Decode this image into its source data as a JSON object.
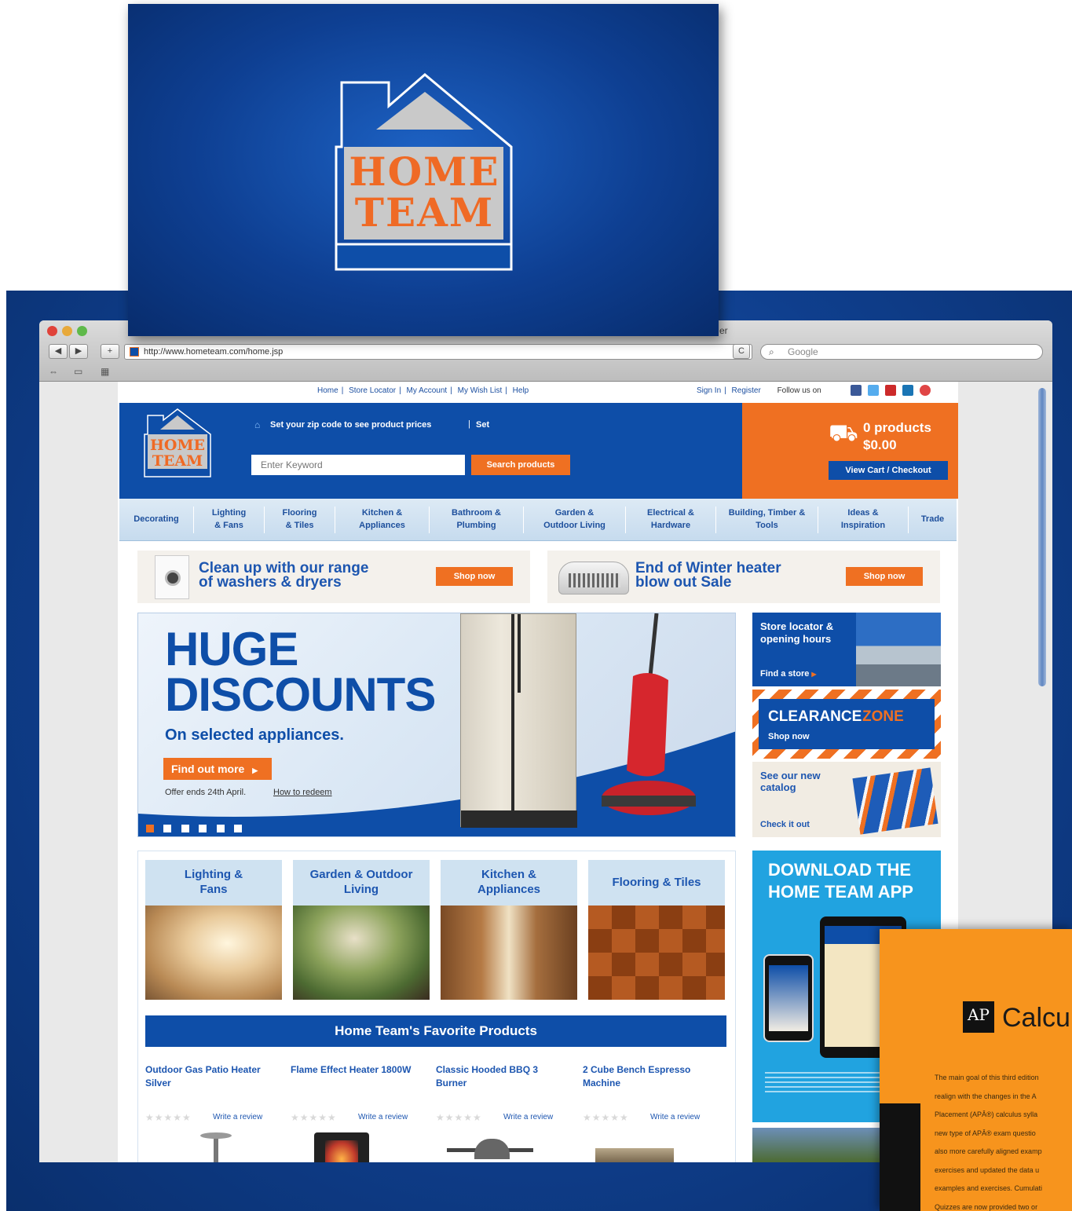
{
  "logo": {
    "line1": "HOME",
    "line2": "TEAM"
  },
  "browser": {
    "url": "http://www.hometeam.com/home.jsp",
    "search_placeholder": "Google",
    "title_fragment": "er",
    "back": "◀",
    "forward": "▶",
    "add": "+",
    "reload": "C"
  },
  "util_nav": {
    "links": [
      "Home",
      "Store Locator",
      "My Account",
      "My Wish List",
      "Help"
    ],
    "sign_in": "Sign In",
    "register": "Register",
    "follow": "Follow us on"
  },
  "header": {
    "zip_text": "Set your zip code to see product prices",
    "zip_set": "Set",
    "search_placeholder": "Enter Keyword",
    "search_button": "Search products",
    "logo_line1": "HOME",
    "logo_line2": "TEAM"
  },
  "cart": {
    "count": "0 products",
    "total": "$0.00",
    "checkout": "View Cart / Checkout"
  },
  "nav": [
    {
      "label": "Decorating"
    },
    {
      "label": "Lighting & Fans"
    },
    {
      "label": "Flooring & Tiles"
    },
    {
      "label": "Kitchen & Appliances"
    },
    {
      "label": "Bathroom & Plumbing"
    },
    {
      "label": "Garden & Outdoor Living"
    },
    {
      "label": "Electrical & Hardware"
    },
    {
      "label": "Building, Timber & Tools"
    },
    {
      "label": "Ideas & Inspiration"
    },
    {
      "label": "Trade"
    }
  ],
  "promos": [
    {
      "line1": "Clean up with our range",
      "line2": "of washers & dryers",
      "button": "Shop now"
    },
    {
      "line1": "End of Winter heater",
      "line2": "blow out Sale",
      "button": "Shop now"
    }
  ],
  "hero": {
    "line1": "HUGE",
    "line2": "DISCOUNTS",
    "sub": "On selected appliances.",
    "button": "Find out more",
    "offer": "Offer ends 24th April.",
    "redeem": "How to redeem"
  },
  "side": {
    "store_title": "Store locator & opening hours",
    "store_link": "Find a store",
    "clearance1": "CLEARANCE",
    "clearance2": "ZONE",
    "clearance_link": "Shop now",
    "catalog_title": "See our new catalog",
    "catalog_link": "Check it out",
    "app_title1": "DOWNLOAD THE",
    "app_title2": "HOME TEAM APP"
  },
  "categories": [
    {
      "label": "Lighting & Fans"
    },
    {
      "label": "Garden & Outdoor Living"
    },
    {
      "label": "Kitchen & Appliances"
    },
    {
      "label": "Flooring & Tiles"
    }
  ],
  "favorites": {
    "title": "Home Team's Favorite Products",
    "products": [
      {
        "name": "Outdoor Gas Patio Heater Silver",
        "review": "Write a review"
      },
      {
        "name": "Flame Effect Heater 1800W",
        "review": "Write a review"
      },
      {
        "name": "Classic Hooded BBQ 3 Burner",
        "review": "Write a review"
      },
      {
        "name": "2 Cube Bench Espresso Machine",
        "review": "Write a review"
      }
    ]
  },
  "book": {
    "logo": "AP",
    "title": "Calcul",
    "lines": [
      "The main goal of this third edition",
      "realign with the changes in the A",
      "Placement (APÂ®) calculus sylla",
      "new type of APÂ® exam questio",
      "also more carefully aligned examp",
      "exercises and updated the data u",
      "examples and exercises. Cumulati",
      "Quizzes are now provided two or"
    ]
  },
  "colors": {
    "brand_blue": "#0e4ea8",
    "brand_orange": "#ef7022",
    "light_blue": "#cfe2f1",
    "app_blue": "#21a3e0"
  }
}
